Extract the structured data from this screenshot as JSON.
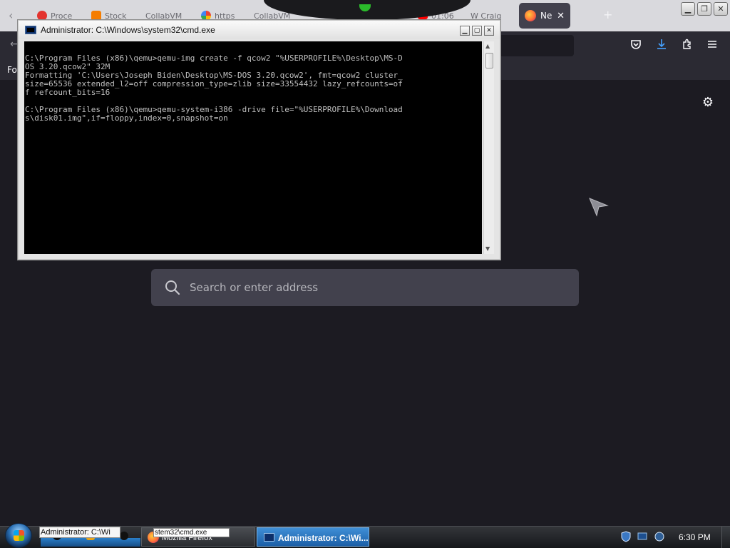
{
  "colors": {
    "firefox_bg": "#1c1b22",
    "firefox_toolbar": "#2b2a33",
    "search_bg": "#42414d",
    "console_bg": "#000000",
    "console_text": "#c0c0c0",
    "taskbar_active": "#1c5fa7"
  },
  "browser": {
    "tabs": [
      {
        "label": "Proce",
        "favicon_color": "#e3342f"
      },
      {
        "label": "Stock",
        "favicon_color": "#f57d00"
      },
      {
        "label": "CollabVM",
        "favicon_color": ""
      },
      {
        "label": "https",
        "favicon_color": "#4285f4"
      },
      {
        "label": "CollabVM",
        "favicon_color": ""
      },
      {
        "label": "01:06",
        "favicon_color": "#ff0000"
      },
      {
        "label": "W  Craig",
        "favicon_color": ""
      }
    ],
    "active_tab": {
      "label": "Ne",
      "close": "✕"
    },
    "new_tab": "+",
    "back": "‹",
    "toolbar_back": "←",
    "bookmark_partial": "Fo",
    "toolbar_icons": [
      "pocket-icon",
      "downloads-icon",
      "extensions-icon",
      "menu-icon"
    ],
    "settings_icon": "gear-icon",
    "search": {
      "placeholder": "Search or enter address"
    }
  },
  "cmd_window": {
    "title": "Administrator: C:\\Windows\\system32\\cmd.exe",
    "lines": [
      "",
      "C:\\Program Files (x86)\\qemu>qemu-img create -f qcow2 \"%USERPROFILE%\\Desktop\\MS-D",
      "OS 3.20.qcow2\" 32M",
      "Formatting 'C:\\Users\\Joseph Biden\\Desktop\\MS-DOS 3.20.qcow2', fmt=qcow2 cluster_",
      "size=65536 extended_l2=off compression_type=zlib size=33554432 lazy_refcounts=of",
      "f refcount_bits=16",
      "",
      "C:\\Program Files (x86)\\qemu>qemu-system-i386 -drive file=\"%USERPROFILE%\\Download",
      "s\\disk01.img\",if=floppy,index=0,snapshot=on"
    ]
  },
  "taskbar": {
    "tooltip": "Administrator: C:\\Wi",
    "firefox_label": "Mozilla Firefox",
    "sub_tooltip": "stem32\\cmd.exe",
    "cmd_label": "Administrator: C:\\Wi...",
    "clock": "6:30 PM"
  }
}
